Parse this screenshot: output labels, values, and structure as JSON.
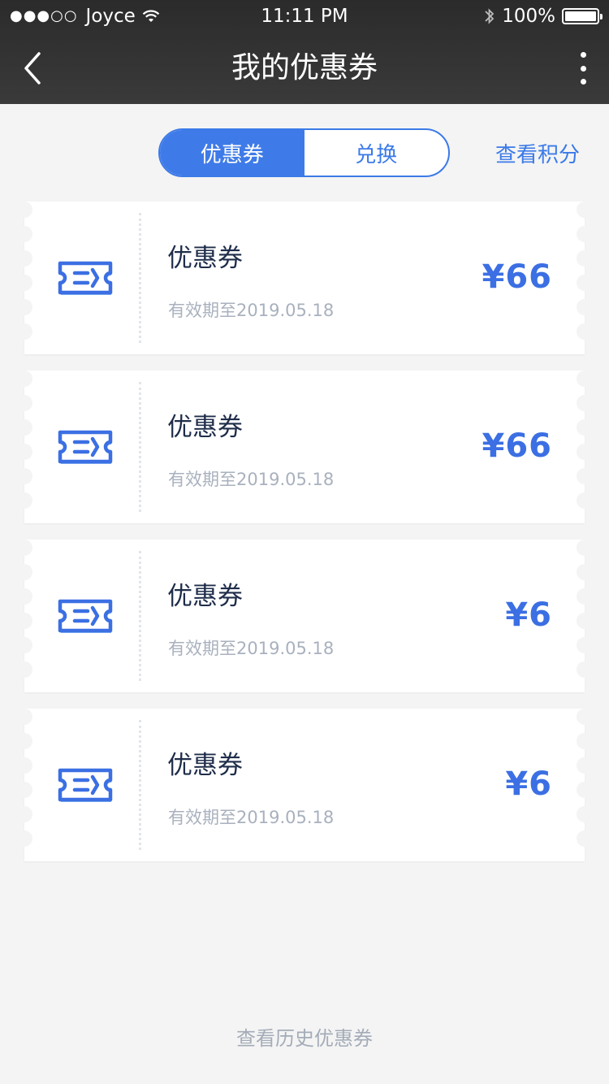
{
  "status_bar": {
    "signal": "●●●○○",
    "carrier": "Joyce",
    "time": "11:11 PM",
    "battery_text": "100%",
    "battery_level": 1.0
  },
  "nav": {
    "title": "我的优惠券",
    "back_icon": "chevron-left-icon",
    "more_icon": "more-vertical-icon"
  },
  "segment": {
    "tabs": [
      {
        "label": "优惠券",
        "active": true
      },
      {
        "label": "兑换",
        "active": false
      }
    ]
  },
  "points_link": "查看积分",
  "coupons": [
    {
      "title": "优惠券",
      "validity": "有效期至2019.05.18",
      "amount": "¥66"
    },
    {
      "title": "优惠券",
      "validity": "有效期至2019.05.18",
      "amount": "¥66"
    },
    {
      "title": "优惠券",
      "validity": "有效期至2019.05.18",
      "amount": "¥6"
    },
    {
      "title": "优惠券",
      "validity": "有效期至2019.05.18",
      "amount": "¥6"
    }
  ],
  "history_link": "查看历史优惠券",
  "colors": {
    "accent": "#3b7ae8",
    "nav_background": "#2e2e2e",
    "page_background": "#f4f4f4"
  }
}
